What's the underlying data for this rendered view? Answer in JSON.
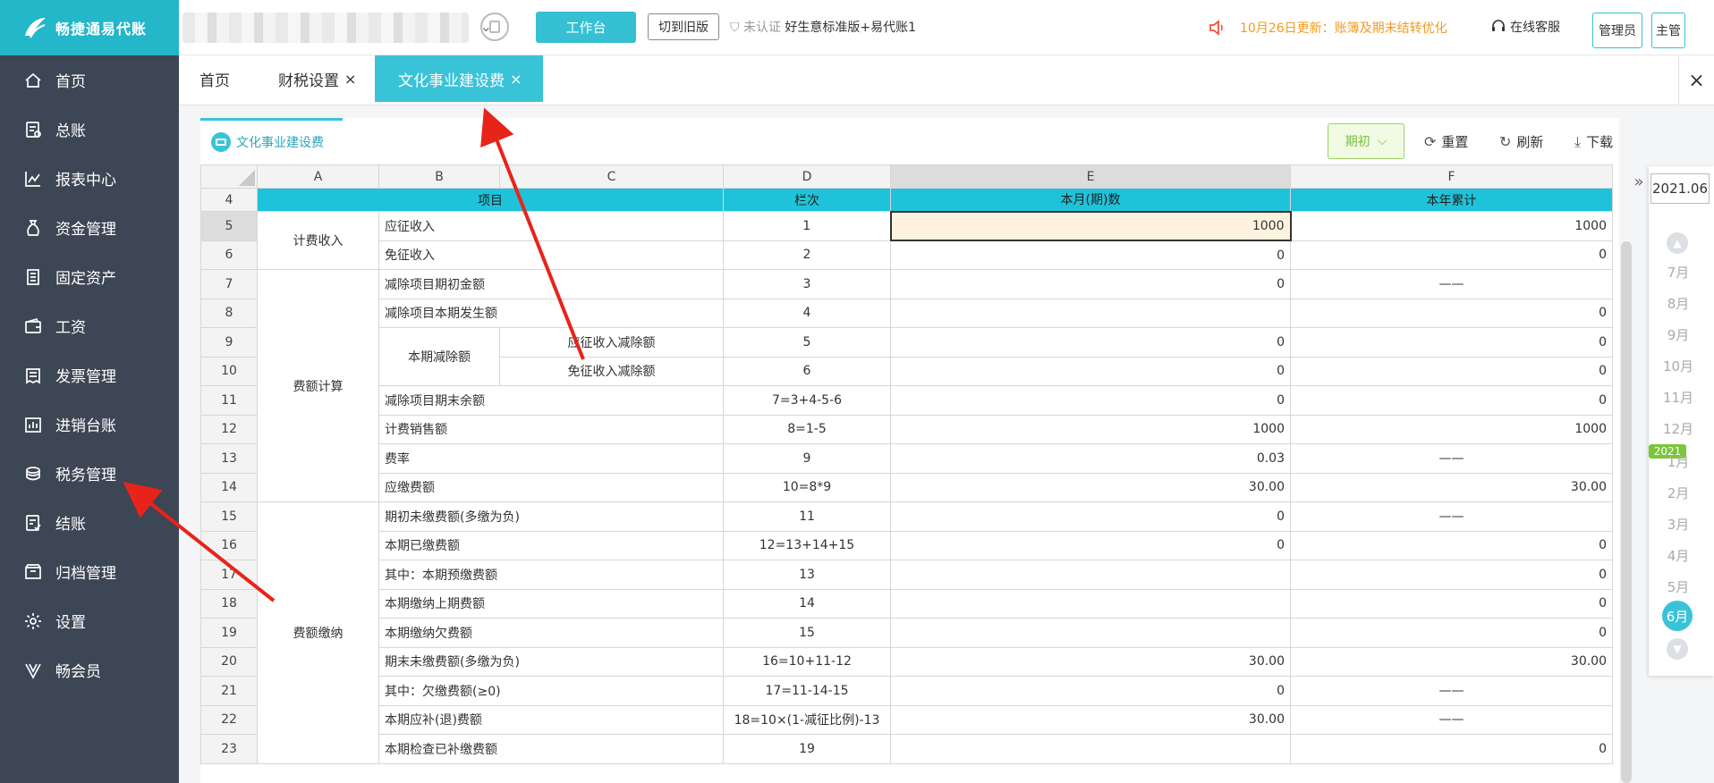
{
  "app": {
    "name": "畅捷通易代账"
  },
  "header": {
    "workbench_label": "工作台",
    "switch_old_label": "切到旧版",
    "cert_status": "未认证",
    "account_name": "好生意标准版+易代账1",
    "notice": "10月26日更新：账簿及期末结转优化",
    "service_label": "在线客服",
    "role_admin": "管理员",
    "role_supervisor": "主管"
  },
  "sidebar": {
    "items": [
      {
        "label": "首页",
        "icon": "home-icon"
      },
      {
        "label": "总账",
        "icon": "ledger-icon"
      },
      {
        "label": "报表中心",
        "icon": "chart-icon"
      },
      {
        "label": "资金管理",
        "icon": "money-bag-icon"
      },
      {
        "label": "固定资产",
        "icon": "building-icon"
      },
      {
        "label": "工资",
        "icon": "wallet-icon"
      },
      {
        "label": "发票管理",
        "icon": "invoice-icon"
      },
      {
        "label": "进销台账",
        "icon": "inventory-icon"
      },
      {
        "label": "税务管理",
        "icon": "tax-icon"
      },
      {
        "label": "结账",
        "icon": "checkout-icon"
      },
      {
        "label": "归档管理",
        "icon": "archive-icon"
      },
      {
        "label": "设置",
        "icon": "gear-icon"
      },
      {
        "label": "畅会员",
        "icon": "vip-icon"
      }
    ]
  },
  "tabs": [
    {
      "label": "首页",
      "closable": false
    },
    {
      "label": "财税设置",
      "closable": true
    },
    {
      "label": "文化事业建设费",
      "closable": true,
      "active": true
    }
  ],
  "close_symbol": "×",
  "report": {
    "subtab_label": "文化事业建设费",
    "period_button": "期初",
    "reset_label": "重置",
    "refresh_label": "刷新",
    "download_label": "下载"
  },
  "sheet": {
    "columns": [
      "A",
      "B",
      "C",
      "D",
      "E",
      "F"
    ],
    "header": {
      "row": "4",
      "item": "项目",
      "line": "栏次",
      "current": "本月(期)数",
      "ytd": "本年累计"
    },
    "groups": {
      "g1": "计费收入",
      "g2": "费额计算",
      "g3": "费额缴纳",
      "sub": "本期减除额"
    },
    "rows": [
      {
        "n": "5",
        "item": "应征收入",
        "line": "1",
        "e": "1000",
        "f": "1000"
      },
      {
        "n": "6",
        "item": "免征收入",
        "line": "2",
        "e": "0",
        "f": "0"
      },
      {
        "n": "7",
        "item": "减除项目期初金额",
        "line": "3",
        "e": "0",
        "f": "——"
      },
      {
        "n": "8",
        "item": "减除项目本期发生额",
        "line": "4",
        "e": "",
        "f": "0"
      },
      {
        "n": "9",
        "item": "应征收入减除额",
        "line": "5",
        "e": "0",
        "f": "0"
      },
      {
        "n": "10",
        "item": "免征收入减除额",
        "line": "6",
        "e": "0",
        "f": "0"
      },
      {
        "n": "11",
        "item": "减除项目期末余额",
        "line": "7=3+4-5-6",
        "e": "0",
        "f": "0"
      },
      {
        "n": "12",
        "item": "计费销售额",
        "line": "8=1-5",
        "e": "1000",
        "f": "1000"
      },
      {
        "n": "13",
        "item": "费率",
        "line": "9",
        "e": "0.03",
        "f": "——"
      },
      {
        "n": "14",
        "item": "应缴费额",
        "line": "10=8*9",
        "e": "30.00",
        "f": "30.00"
      },
      {
        "n": "15",
        "item": "期初未缴费额(多缴为负)",
        "line": "11",
        "e": "0",
        "f": "——"
      },
      {
        "n": "16",
        "item": "本期已缴费额",
        "line": "12=13+14+15",
        "e": "0",
        "f": "0"
      },
      {
        "n": "17",
        "item": "其中：本期预缴费额",
        "line": "13",
        "e": "",
        "f": "0"
      },
      {
        "n": "18",
        "item": "本期缴纳上期费额",
        "line": "14",
        "e": "",
        "f": "0"
      },
      {
        "n": "19",
        "item": "本期缴纳欠费额",
        "line": "15",
        "e": "",
        "f": "0"
      },
      {
        "n": "20",
        "item": "期末未缴费额(多缴为负)",
        "line": "16=10+11-12",
        "e": "30.00",
        "f": "30.00"
      },
      {
        "n": "21",
        "item": "其中：欠缴费额(≥0)",
        "line": "17=11-14-15",
        "e": "0",
        "f": "——"
      },
      {
        "n": "22",
        "item": "本期应补(退)费额",
        "line": "18=10×(1-减征比例)-13",
        "e": "30.00",
        "f": "——"
      },
      {
        "n": "23",
        "item": "本期检查已补缴费额",
        "line": "19",
        "e": "",
        "f": "0"
      }
    ]
  },
  "period_rail": {
    "current_date": "2021.06",
    "months_top": [
      "7月",
      "8月",
      "9月",
      "10月",
      "11月",
      "12月"
    ],
    "year_badge": "2021",
    "months_bottom": [
      "1月",
      "2月",
      "3月",
      "4月",
      "5月"
    ],
    "current_month": "6月"
  },
  "colors": {
    "brand": "#24b6c9",
    "sidebar_bg": "#3d4654",
    "header_row": "#1fc3d9",
    "notice": "#f39a1d",
    "annotation": "#e8231a"
  }
}
